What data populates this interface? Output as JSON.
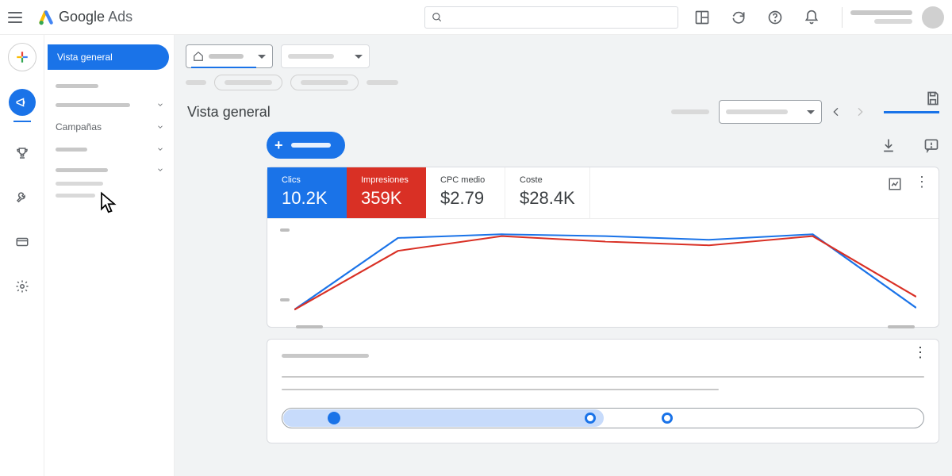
{
  "header": {
    "product_a": "Google",
    "product_b": "Ads"
  },
  "nav": {
    "active_label": "Vista general",
    "campaigns_label": "Campañas"
  },
  "page": {
    "title": "Vista general"
  },
  "metrics": [
    {
      "label": "Clics",
      "value": "10.2K",
      "style": "blue"
    },
    {
      "label": "Impresiones",
      "value": "359K",
      "style": "red"
    },
    {
      "label": "CPC medio",
      "value": "$2.79",
      "style": "plain"
    },
    {
      "label": "Coste",
      "value": "$28.4K",
      "style": "plain"
    }
  ],
  "chart_data": {
    "type": "line",
    "x": [
      0,
      1,
      2,
      3,
      4,
      5,
      6
    ],
    "series": [
      {
        "name": "Clics",
        "color": "#1a73e8",
        "values": [
          10,
          88,
          92,
          90,
          86,
          92,
          12
        ]
      },
      {
        "name": "Impresiones",
        "color": "#d93025",
        "values": [
          10,
          74,
          90,
          84,
          80,
          90,
          24
        ]
      }
    ],
    "ylim": [
      0,
      100
    ]
  },
  "stepper": {
    "progress_pct": 50,
    "nodes_pct": [
      8,
      48,
      60
    ]
  }
}
